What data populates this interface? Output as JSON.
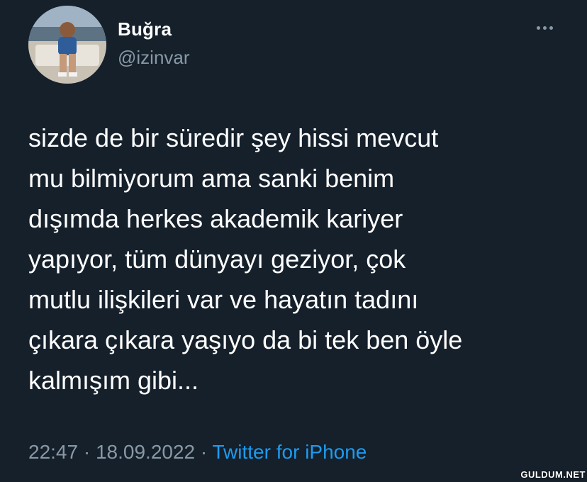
{
  "author": {
    "display_name": "Buğra",
    "handle": "@izinvar"
  },
  "tweet": {
    "lines": [
      "sizde de bir süredir şey hissi mevcut",
      "mu bilmiyorum ama sanki benim",
      "dışımda herkes akademik kariyer",
      "yapıyor, tüm dünyayı geziyor, çok",
      "mutlu ilişkileri var ve hayatın tadını",
      "çıkara çıkara yaşıyo da bi tek ben öyle",
      "kalmışım gibi..."
    ],
    "time": "22:47",
    "separator": "·",
    "date": "18.09.2022",
    "source": "Twitter for iPhone"
  },
  "watermark": "GULDUM.NET",
  "icons": {
    "more": "more-horizontal-icon"
  },
  "colors": {
    "background": "#15202b",
    "text": "#ffffff",
    "secondary": "#8899a6",
    "link": "#1d9bf0"
  }
}
